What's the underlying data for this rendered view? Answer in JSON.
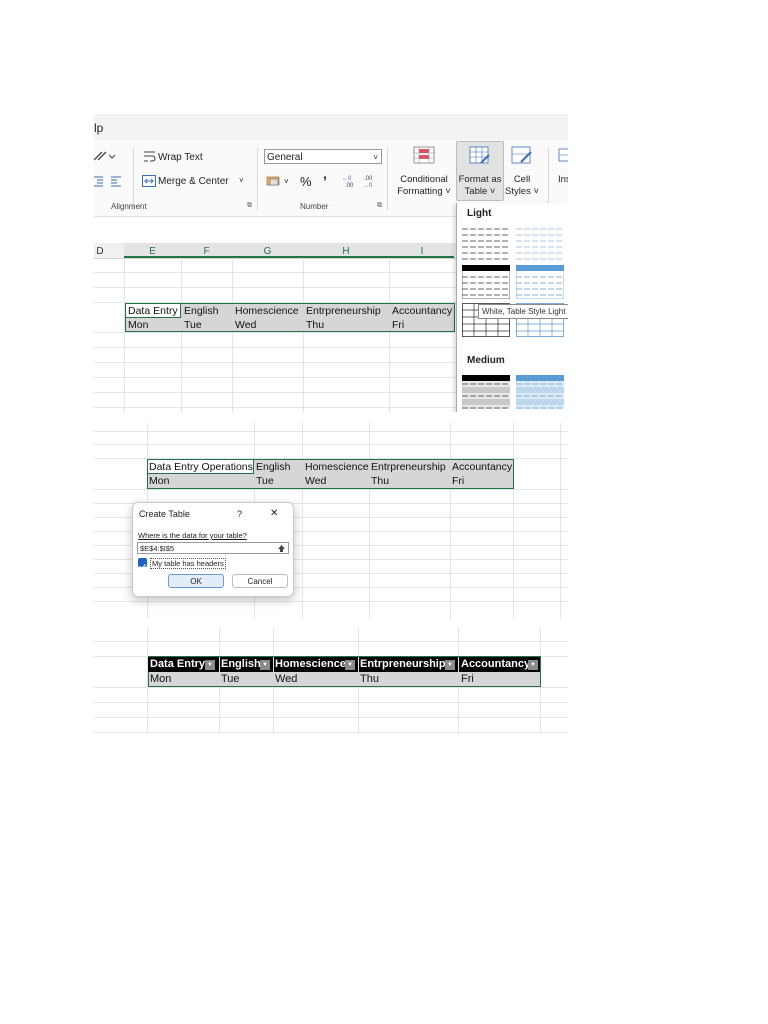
{
  "ribbon": {
    "tab_fragment": "lp",
    "wrap_text": "Wrap Text",
    "merge_center": "Merge & Center",
    "number_format": "General",
    "percent": "%",
    "comma": "’",
    "alignment_label": "Alignment",
    "number_label": "Number",
    "conditional_formatting_1": "Conditional",
    "conditional_formatting_2": "Formatting ˅",
    "format_as_table_1": "Format as",
    "format_as_table_2": "Table ˅",
    "cell_styles_1": "Cell",
    "cell_styles_2": "Styles ˅",
    "insert_fragment": "Ins"
  },
  "panel1": {
    "columns": [
      "D",
      "E",
      "F",
      "G",
      "H",
      "I"
    ],
    "row1": [
      "Data Entry",
      "English",
      "Homescience",
      "Entrpreneurship",
      "Accountancy"
    ],
    "row2": [
      "Mon",
      "Tue",
      "Wed",
      "Thu",
      "Fri"
    ]
  },
  "gallery": {
    "light_label": "Light",
    "medium_label": "Medium",
    "tooltip": "White, Table Style Light"
  },
  "panel2": {
    "row1": [
      "Data Entry Operations",
      "English",
      "Homescience",
      "Entrpreneurship",
      "Accountancy"
    ],
    "row2": [
      "Mon",
      "Tue",
      "Wed",
      "Thu",
      "Fri"
    ]
  },
  "dialog": {
    "title": "Create Table",
    "help": "?",
    "close": "✕",
    "prompt": "Where is the data for your table?",
    "range": "$E$4:$I$5",
    "headers_label": "My table has headers",
    "ok": "OK",
    "cancel": "Cancel"
  },
  "panel3": {
    "headers": [
      "Data Entry",
      "English",
      "Homescience",
      "Entrpreneurship",
      "Accountancy"
    ],
    "row2": [
      "Mon",
      "Tue",
      "Wed",
      "Thu",
      "Fri"
    ]
  }
}
